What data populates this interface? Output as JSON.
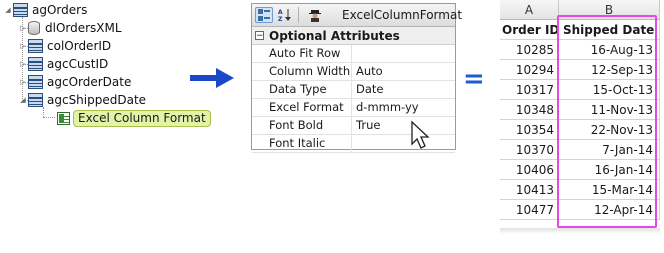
{
  "tree": {
    "root": "agOrders",
    "items": [
      {
        "label": "dlOrdersXML",
        "icon": "datalayer-icon"
      },
      {
        "label": "colOrderID",
        "icon": "grid-column-icon"
      },
      {
        "label": "agcCustID",
        "icon": "grid-column-icon"
      },
      {
        "label": "agcOrderDate",
        "icon": "grid-column-icon"
      },
      {
        "label": "agcShippedDate",
        "icon": "grid-column-icon"
      }
    ],
    "selected": {
      "label": "Excel Column Format",
      "icon": "excel-format-icon"
    }
  },
  "property_panel": {
    "title": "ExcelColumnFormat",
    "group": "Optional Attributes",
    "rows": [
      {
        "name": "Auto Fit Row",
        "value": ""
      },
      {
        "name": "Column Width",
        "value": "Auto"
      },
      {
        "name": "Data Type",
        "value": "Date"
      },
      {
        "name": "Excel Format",
        "value": "d-mmm-yy"
      },
      {
        "name": "Font Bold",
        "value": "True"
      },
      {
        "name": "Font Italic",
        "value": ""
      }
    ]
  },
  "equals_sign": "=",
  "spreadsheet": {
    "columns": [
      "A",
      "B"
    ],
    "headers": [
      "Order ID",
      "Shipped Date"
    ],
    "rows": [
      [
        "10285",
        "16-Aug-13"
      ],
      [
        "10294",
        "12-Sep-13"
      ],
      [
        "10317",
        "15-Oct-13"
      ],
      [
        "10348",
        "11-Nov-13"
      ],
      [
        "10354",
        "22-Nov-13"
      ],
      [
        "10370",
        "7-Jan-14"
      ],
      [
        "10406",
        "16-Jan-14"
      ],
      [
        "10413",
        "15-Mar-14"
      ],
      [
        "10477",
        "12-Apr-14"
      ]
    ]
  },
  "colors": {
    "arrow": "#1b47c9",
    "equals": "#1b5cd6",
    "highlight_border": "#e14be3",
    "selected_node_bg": "#e4f2a8"
  }
}
